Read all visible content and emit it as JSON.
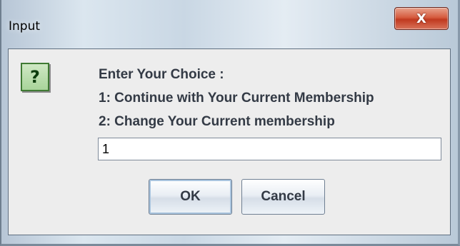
{
  "window": {
    "title": "Input",
    "close_glyph": "X"
  },
  "dialog": {
    "icon": "question-icon",
    "icon_glyph": "?",
    "message_lines": [
      "Enter Your Choice :",
      "1: Continue with Your Current Membership",
      "2: Change Your Current membership"
    ],
    "input_value": "1"
  },
  "buttons": {
    "ok_label": "OK",
    "cancel_label": "Cancel"
  },
  "colors": {
    "close_button": "#c0391f",
    "icon_background": "#a8d49a",
    "text": "#333a45"
  }
}
